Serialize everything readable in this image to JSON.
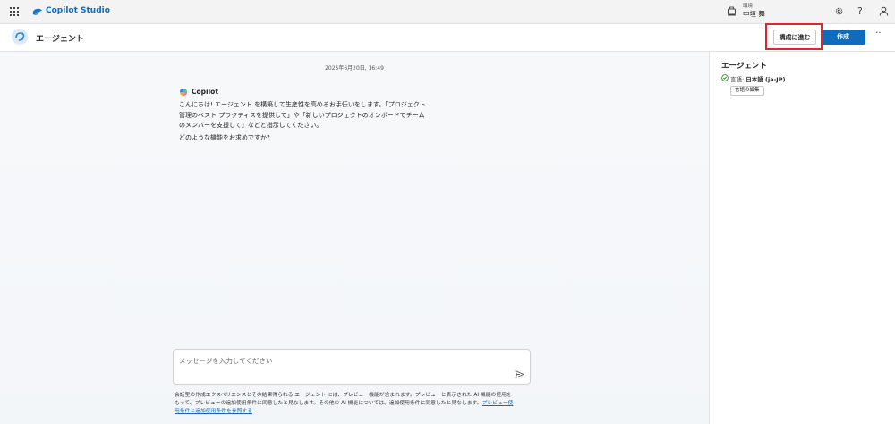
{
  "topbar": {
    "brand": "Copilot Studio",
    "environment_label": "環境",
    "environment_value": "中垣 舞",
    "help_glyph": "?"
  },
  "header": {
    "title": "エージェント",
    "configure_label": "構成に進む",
    "create_label": "作成",
    "more_glyph": "···"
  },
  "chat": {
    "timestamp": "2025年6月20日, 16:49",
    "sender": "Copilot",
    "message_lines": [
      "こんにちは! エージェント を構築して生産性を高めるお手伝いをします。「プロジェクト",
      "管理のベスト プラクティスを提供して」や「新しいプロジェクトのオンボードでチーム",
      "のメンバーを支援して」などと指示してください。",
      "どのような機能をお求めですか?"
    ],
    "input_placeholder": "メッセージを入力してください",
    "disclaimer_line1": "会話型の作成エクスペリエンスとその結果得られる エージェント には、プレビュー機能が含まれます。プレビューと表示された AI 機能の使用を",
    "disclaimer_line2": "もって、プレビューの追加使用条件に同意したと見なします。その他の AI 機能については、追加使用条件に同意したと見なします。",
    "disclaimer_link_part1": "プレビュー使",
    "disclaimer_link_part2": "用条件と追加使用条件を参照する"
  },
  "panel": {
    "title": "エージェント",
    "language_label": "言語: ",
    "language_value": "日本語 (ja-JP)",
    "edit_language_label": "言語の編集"
  },
  "colors": {
    "accent": "#0f6cbd",
    "highlight": "#e3222b",
    "success": "#107c10"
  },
  "icons": [
    "waffle-icon",
    "copilot-studio-logo-icon",
    "environment-icon",
    "gear-icon",
    "help-icon",
    "user-icon",
    "agent-avatar-icon",
    "copilot-logo-icon",
    "send-icon",
    "check-circle-icon"
  ]
}
